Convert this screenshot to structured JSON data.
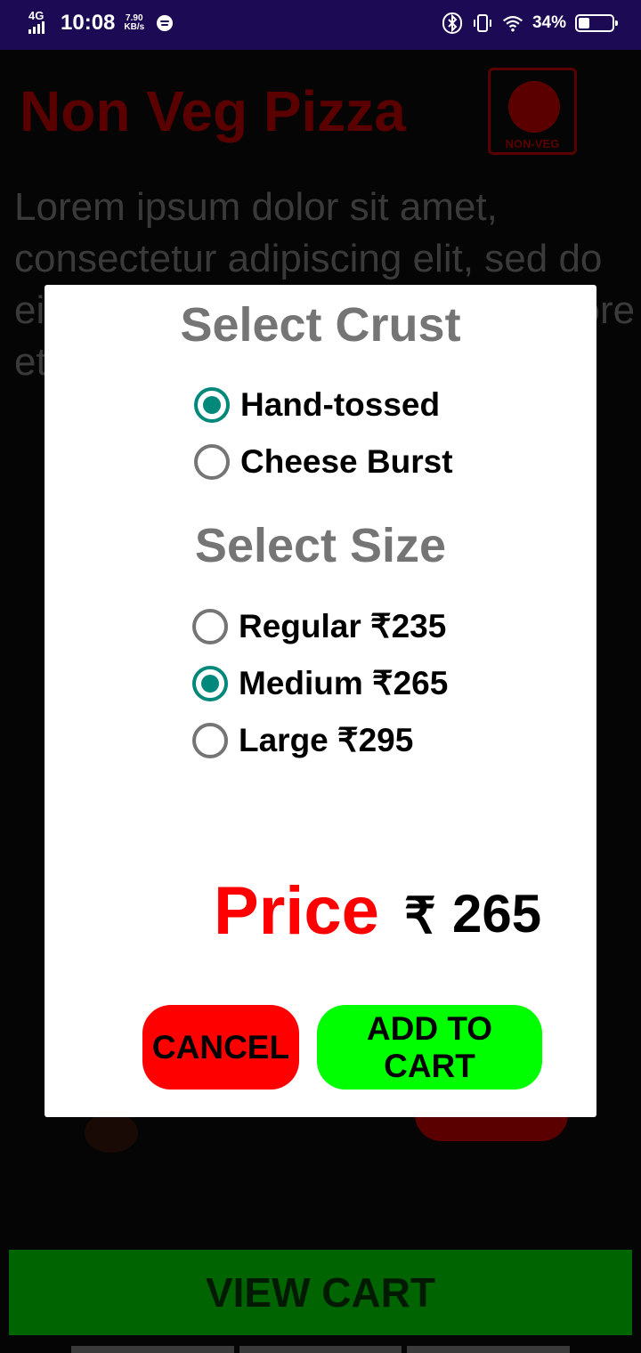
{
  "status_bar": {
    "network": "4G",
    "time": "10:08",
    "speed_value": "7.90",
    "speed_unit": "KB/s",
    "battery_percent": "34%",
    "battery_level": 0.34,
    "icons": [
      "signal-icon",
      "spotify-icon",
      "bluetooth-icon",
      "vibrate-icon",
      "wifi-icon",
      "battery-icon"
    ]
  },
  "background": {
    "title": "Non Veg Pizza",
    "badge_label": "NON-VEG",
    "description": "Lorem ipsum dolor sit amet, consectetur adipiscing elit, sed do eiusmod tempor incididunt ut labore et dolore magna aliqua.",
    "view_cart_label": "VIEW CART"
  },
  "dialog": {
    "crust_title": "Select Crust",
    "crust_options": [
      {
        "label": "Hand-tossed",
        "checked": true
      },
      {
        "label": "Cheese Burst",
        "checked": false
      }
    ],
    "size_title": "Select Size",
    "size_options": [
      {
        "label": "Regular ₹235",
        "checked": false
      },
      {
        "label": "Medium ₹265",
        "checked": true
      },
      {
        "label": "Large ₹295",
        "checked": false
      }
    ],
    "price_label": "Price",
    "currency_symbol": "₹",
    "price_value": "265",
    "cancel_label": "CANCEL",
    "add_to_cart_label": "ADD TO CART"
  },
  "colors": {
    "status_bar": "#1d0a54",
    "accent_radio": "#00897b",
    "price": "#ff0000",
    "cancel": "#ff0000",
    "add_to_cart": "#00ff00",
    "view_cart": "#006400"
  }
}
